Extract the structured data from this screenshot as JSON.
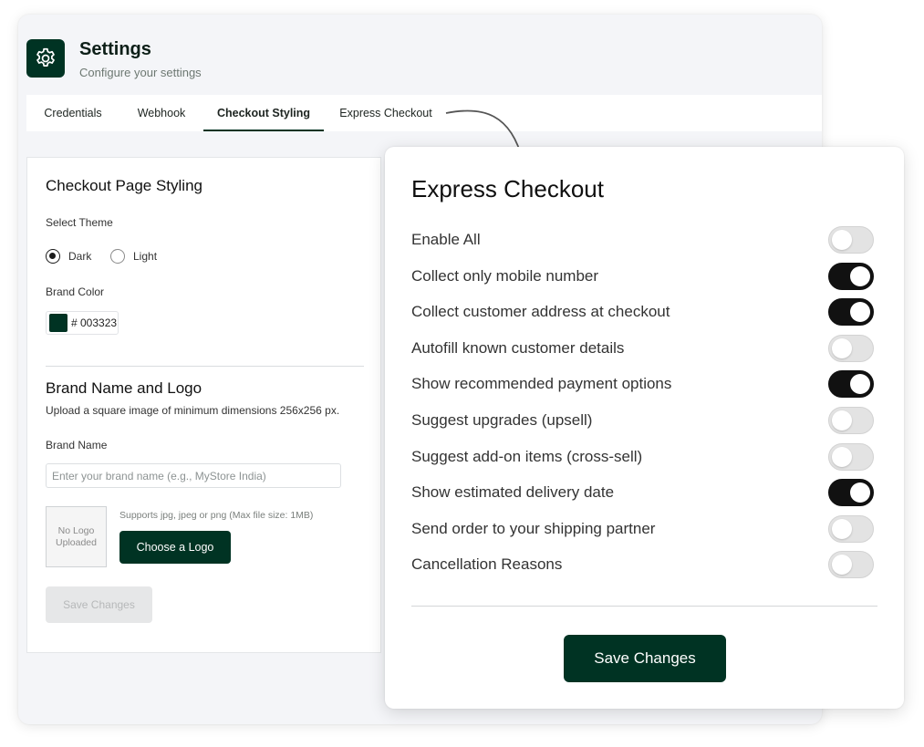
{
  "header": {
    "title": "Settings",
    "subtitle": "Configure your settings",
    "icon": "gear-icon"
  },
  "tabs": [
    {
      "label": "Credentials",
      "active": false
    },
    {
      "label": "Webhook",
      "active": false
    },
    {
      "label": "Checkout Styling",
      "active": true
    },
    {
      "label": "Express Checkout",
      "active": false
    }
  ],
  "styling_card": {
    "heading": "Checkout Page Styling",
    "theme_label": "Select Theme",
    "theme_options": [
      {
        "label": "Dark",
        "selected": true
      },
      {
        "label": "Light",
        "selected": false
      }
    ],
    "brand_color_label": "Brand Color",
    "brand_color_value": "# 003323",
    "brand_color_hex": "#003323",
    "brand_section_heading": "Brand Name and Logo",
    "brand_section_hint": "Upload a square image of minimum dimensions 256x256 px.",
    "brand_name_label": "Brand Name",
    "brand_name_placeholder": "Enter your brand name (e.g., MyStore India)",
    "brand_name_value": "",
    "logo_placeholder": "No Logo Uploaded",
    "logo_support_text": "Supports jpg, jpeg or png (Max file size: 1MB)",
    "choose_logo_label": "Choose a Logo",
    "save_label": "Save Changes"
  },
  "express_checkout": {
    "title": "Express Checkout",
    "options": [
      {
        "label": "Enable All",
        "enabled": false
      },
      {
        "label": "Collect only mobile number",
        "enabled": true
      },
      {
        "label": "Collect customer address at checkout",
        "enabled": true
      },
      {
        "label": "Autofill known customer details",
        "enabled": false
      },
      {
        "label": "Show recommended payment options",
        "enabled": true
      },
      {
        "label": "Suggest upgrades (upsell)",
        "enabled": false
      },
      {
        "label": "Suggest add-on items (cross-sell)",
        "enabled": false
      },
      {
        "label": "Show estimated delivery date",
        "enabled": true
      },
      {
        "label": "Send order to your shipping partner",
        "enabled": false
      },
      {
        "label": "Cancellation Reasons",
        "enabled": false
      }
    ],
    "save_label": "Save Changes"
  },
  "colors": {
    "brand": "#003323",
    "toggle_on": "#111111",
    "toggle_off": "#e3e3e3"
  }
}
